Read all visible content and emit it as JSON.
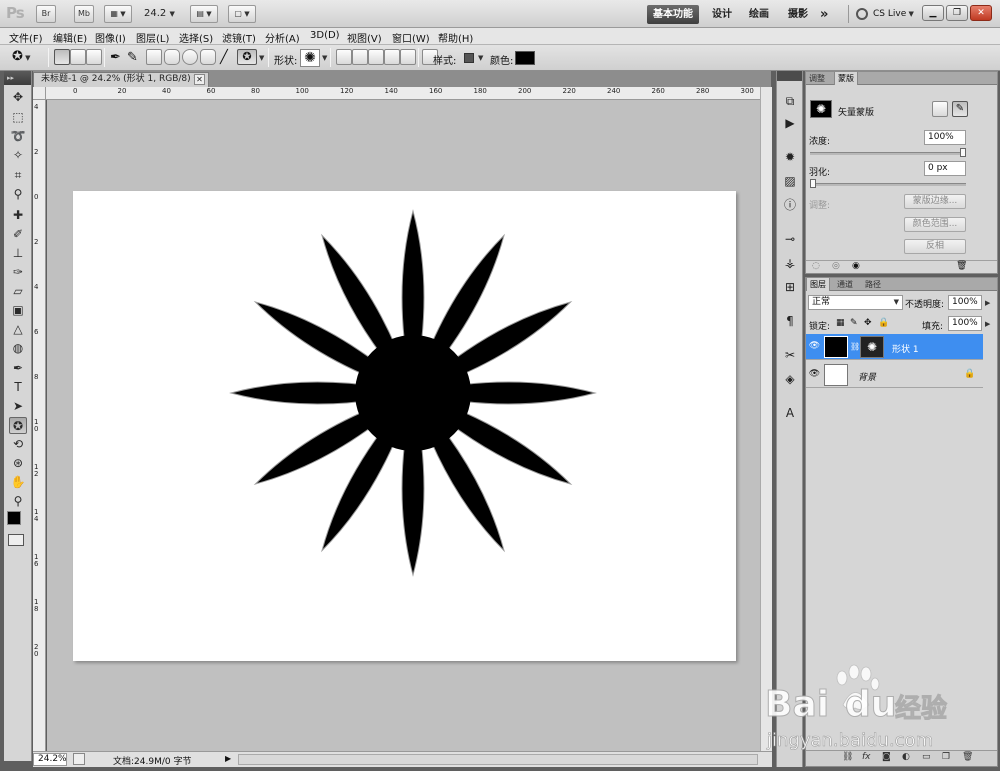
{
  "app": {
    "logo": "Ps",
    "appbar_buttons": [
      "Br",
      "Mb"
    ],
    "zoom_dropdown": "24.2",
    "workspaces": [
      "基本功能",
      "设计",
      "绘画",
      "摄影"
    ],
    "more": "»",
    "cslive": "CS Live"
  },
  "menu": [
    "文件(F)",
    "编辑(E)",
    "图像(I)",
    "图层(L)",
    "选择(S)",
    "滤镜(T)",
    "分析(A)",
    "3D(D)",
    "视图(V)",
    "窗口(W)",
    "帮助(H)"
  ],
  "options": {
    "shape_label": "形状:",
    "style_label": "样式:",
    "color_label": "颜色:",
    "color_value": "#000000"
  },
  "document": {
    "tab_title": "未标题-1 @ 24.2% (形状 1, RGB/8) *",
    "ruler_top": [
      "0",
      "20",
      "40",
      "60",
      "80",
      "100",
      "120",
      "140",
      "160",
      "180",
      "200",
      "220",
      "240",
      "260",
      "280",
      "300"
    ],
    "ruler_left": [
      "4",
      "2",
      "0",
      "2",
      "4",
      "6",
      "8",
      "10",
      "12",
      "14",
      "16",
      "18",
      "20"
    ],
    "zoom": "24.2%",
    "status": "文档:24.9M/0 字节",
    "shape_color": "#000000",
    "artboard_color": "#ffffff"
  },
  "masks_panel": {
    "tabs": [
      "调整",
      "蒙版"
    ],
    "active_tab": "蒙版",
    "vector_mask_label": "矢量蒙版",
    "density_label": "浓度:",
    "density_value": "100%",
    "feather_label": "羽化:",
    "feather_value": "0 px",
    "refine_label": "调整:",
    "mask_edge_btn": "蒙版边缘...",
    "color_range_btn": "颜色范围...",
    "invert_btn": "反相"
  },
  "layers_panel": {
    "tabs": [
      "图层",
      "通道",
      "路径"
    ],
    "active_tab": "图层",
    "blend_mode": "正常",
    "opacity_label": "不透明度:",
    "opacity_value": "100%",
    "lock_label": "锁定:",
    "fill_label": "填充:",
    "fill_value": "100%",
    "layers": [
      {
        "name": "形状 1",
        "selected": true
      },
      {
        "name": "背景",
        "selected": false,
        "locked": true
      }
    ]
  },
  "watermark": {
    "brand": "Bai",
    "brand2": "du",
    "cn": "经验",
    "url": "jingyan.baidu.com"
  },
  "colors": {
    "selection_blue": "#3e8ef0",
    "canvas_gray": "#c0c0c0",
    "workspace_dark": "#4a4a4a"
  }
}
